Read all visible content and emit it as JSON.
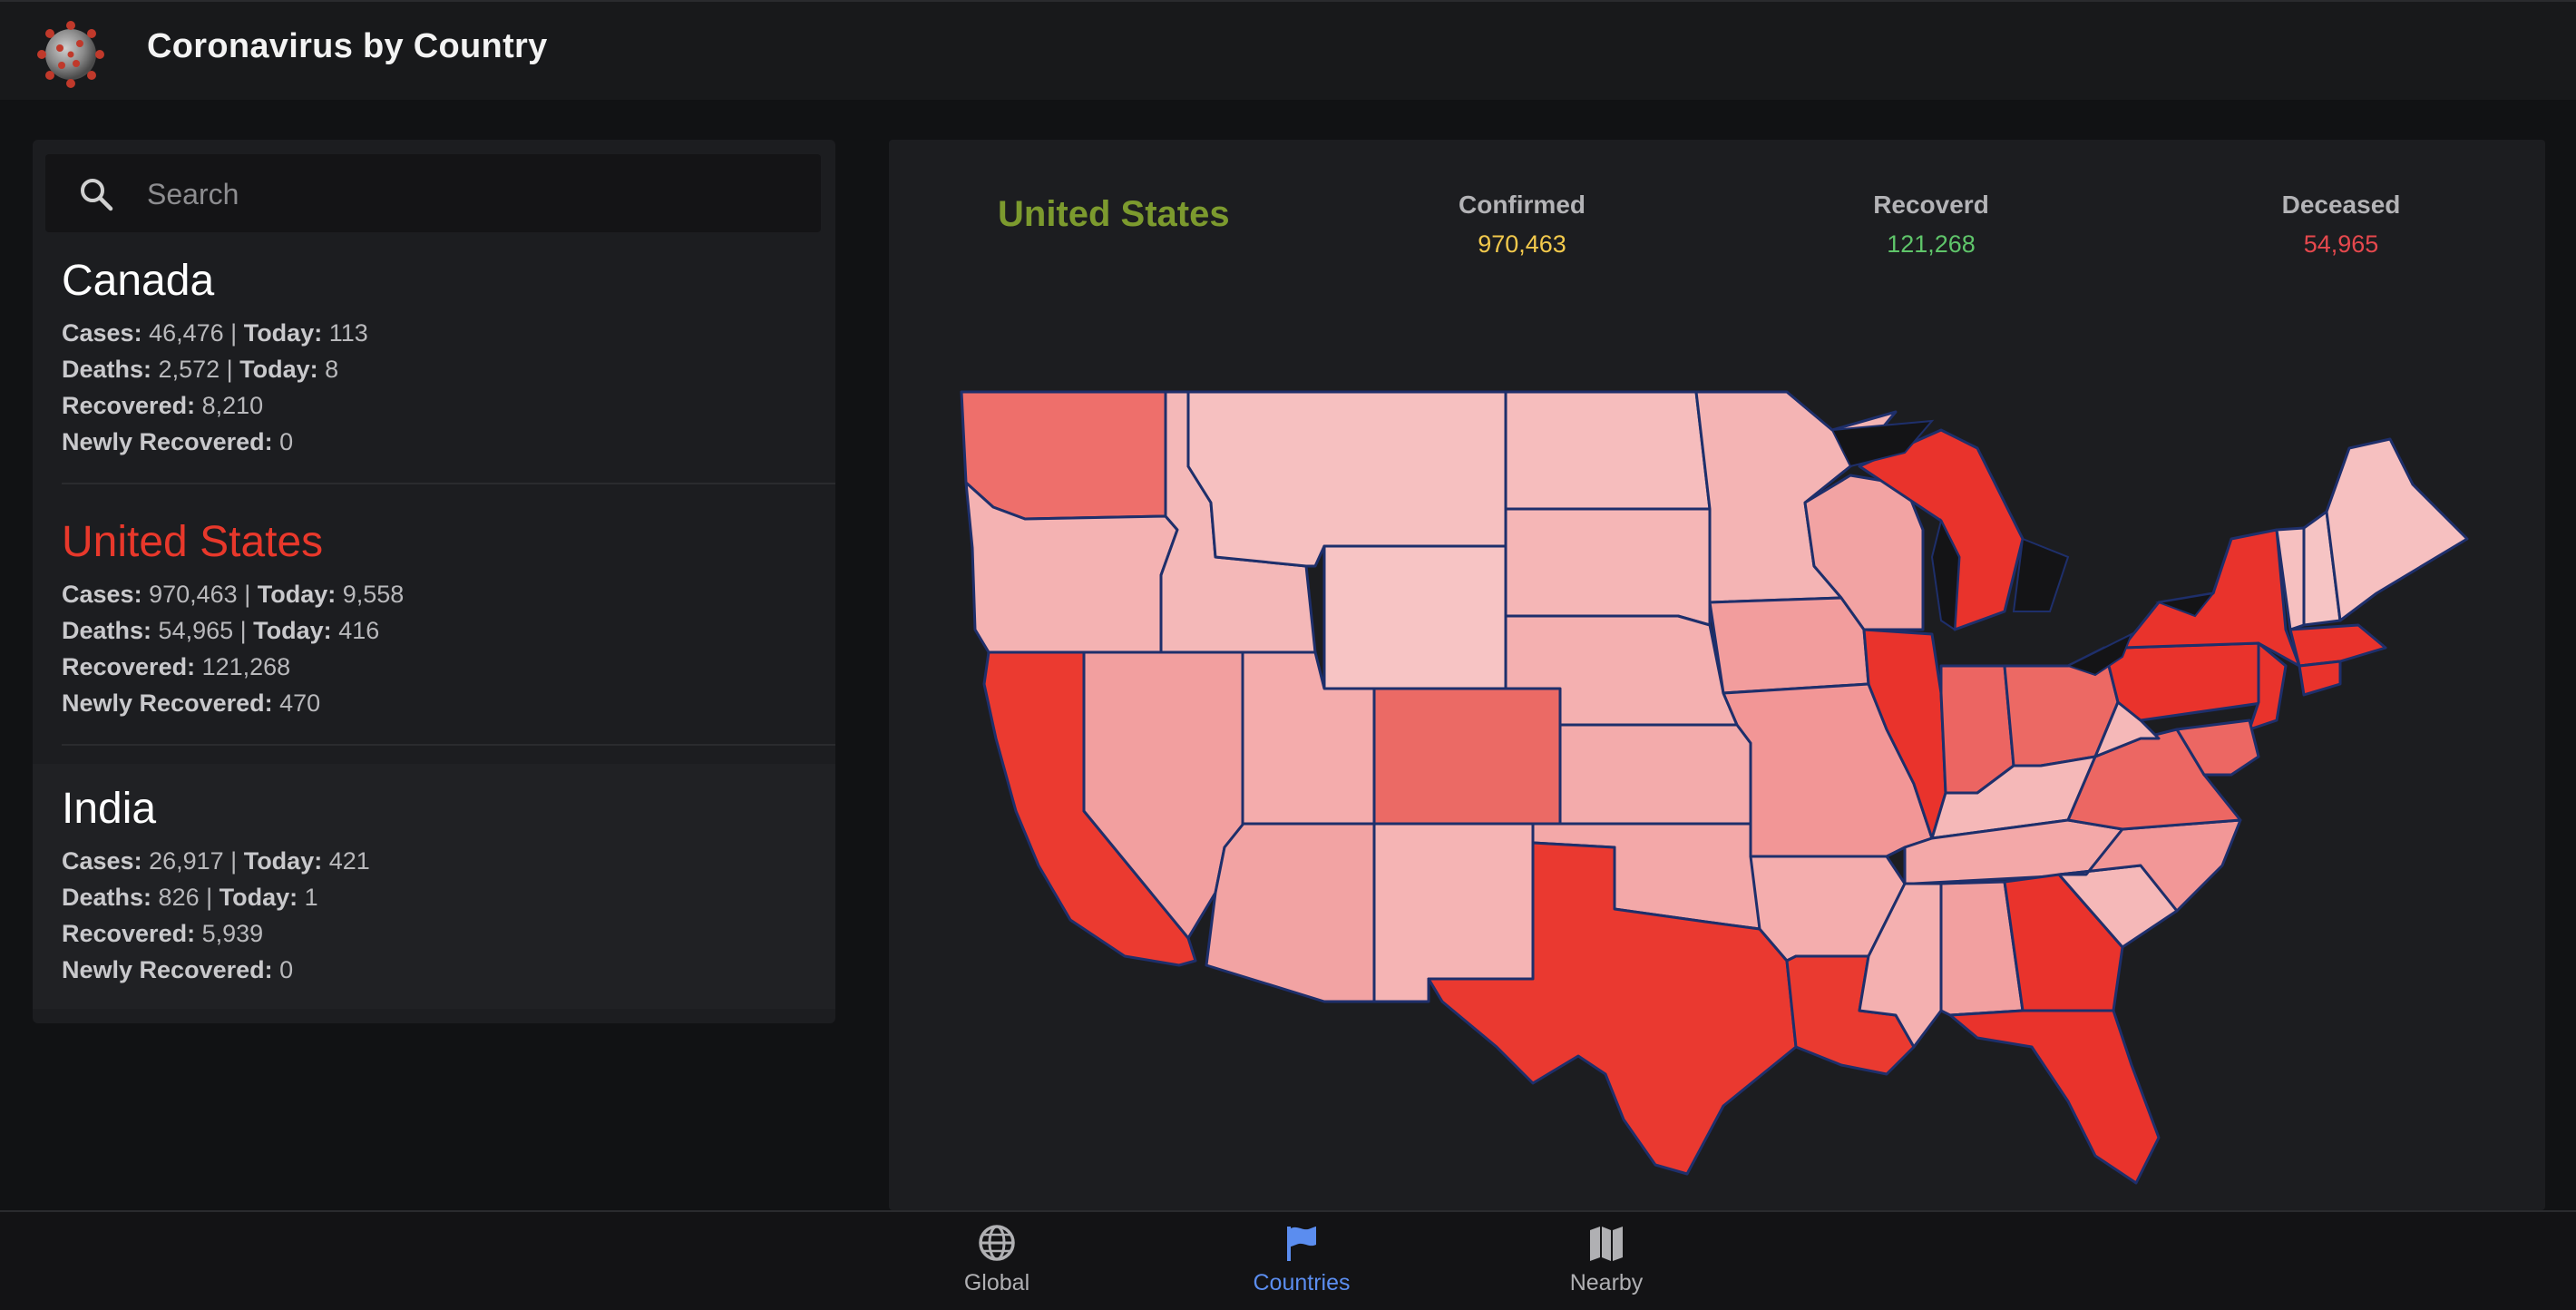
{
  "app": {
    "title": "Coronavirus by Country",
    "logo_icon": "virus-icon"
  },
  "search": {
    "placeholder": "Search",
    "value": ""
  },
  "countries": [
    {
      "name": "Canada",
      "cases_label": "Cases:",
      "cases": "46,476",
      "cases_today_label": "Today:",
      "cases_today": "113",
      "deaths_label": "Deaths:",
      "deaths": "2,572",
      "deaths_today_label": "Today:",
      "deaths_today": "8",
      "recovered_label": "Recovered:",
      "recovered": "8,210",
      "newly_recovered_label": "Newly Recovered:",
      "newly_recovered": "0"
    },
    {
      "name": "United States",
      "cases_label": "Cases:",
      "cases": "970,463",
      "cases_today_label": "Today:",
      "cases_today": "9,558",
      "deaths_label": "Deaths:",
      "deaths": "54,965",
      "deaths_today_label": "Today:",
      "deaths_today": "416",
      "recovered_label": "Recovered:",
      "recovered": "121,268",
      "newly_recovered_label": "Newly Recovered:",
      "newly_recovered": "470"
    },
    {
      "name": "India",
      "cases_label": "Cases:",
      "cases": "26,917",
      "cases_today_label": "Today:",
      "cases_today": "421",
      "deaths_label": "Deaths:",
      "deaths": "826",
      "deaths_today_label": "Today:",
      "deaths_today": "1",
      "recovered_label": "Recovered:",
      "recovered": "5,939",
      "newly_recovered_label": "Newly Recovered:",
      "newly_recovered": "0"
    }
  ],
  "detail": {
    "country": "United States",
    "confirmed_label": "Confirmed",
    "confirmed": "970,463",
    "recovered_label": "Recoverd",
    "recovered": "121,268",
    "deceased_label": "Deceased",
    "deceased": "54,965"
  },
  "colors": {
    "accent_red": "#e8382b",
    "country_title": "#7c9a2e",
    "confirmed": "#f2c94c",
    "recovered": "#5fc56a",
    "deceased": "#e5484d",
    "active_tab": "#5b8def",
    "state_border": "#1e2f6b"
  },
  "nav": {
    "items": [
      {
        "label": "Global",
        "icon": "globe-icon"
      },
      {
        "label": "Countries",
        "icon": "flag-icon"
      },
      {
        "label": "Nearby",
        "icon": "map-icon"
      }
    ],
    "active": "Countries"
  }
}
